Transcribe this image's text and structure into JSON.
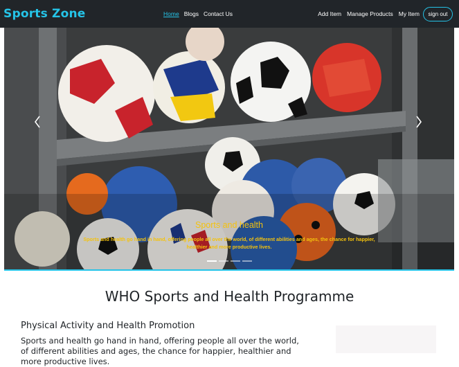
{
  "navbar": {
    "brand": "Sports Zone",
    "left_links": [
      "Home",
      "Blogs",
      "Contact Us"
    ],
    "right_links": [
      "Add Item",
      "Manage Products",
      "My Item"
    ],
    "signout_label": "sign out",
    "accent_color": "#25c4e8"
  },
  "carousel": {
    "caption_title": "Sports and health",
    "caption_text": "Sports and health go hand in hand, offering people all over the world, of different abilities and ages, the chance for happier, healthier and more productive lives.",
    "slide_count": 4,
    "active_slide": 1,
    "prev_icon": "chevron-left-icon",
    "next_icon": "chevron-right-icon",
    "caption_color": "#f4c20d"
  },
  "section": {
    "title": "WHO Sports and Health Programme",
    "subtitle": "Physical Activity and Health Promotion",
    "body": "Sports and health go hand in hand, offering people all over the world, of different abilities and ages, the chance for happier, healthier and more productive lives."
  }
}
